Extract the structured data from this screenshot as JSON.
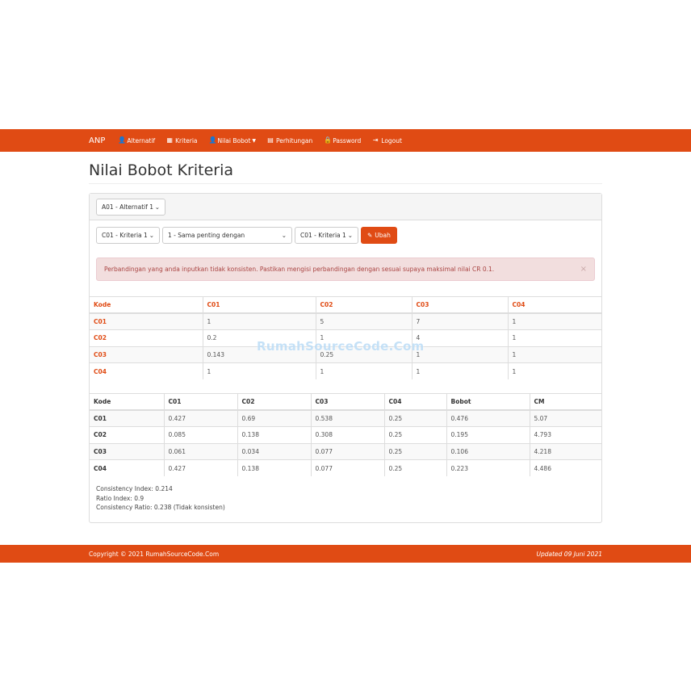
{
  "nav": {
    "brand": "ANP",
    "items": [
      {
        "label": "Alternatif",
        "icon": "user-icon"
      },
      {
        "label": "Kriteria",
        "icon": "grid-icon"
      },
      {
        "label": "Nilai Bobot",
        "icon": "user-icon"
      },
      {
        "label": "Perhitungan",
        "icon": "calendar-icon"
      },
      {
        "label": "Password",
        "icon": "lock-icon"
      },
      {
        "label": "Logout",
        "icon": "logout-icon"
      }
    ]
  },
  "page": {
    "title": "Nilai Bobot Kriteria"
  },
  "form": {
    "alternatif": "A01 - Alternatif 1",
    "kriteria1": "C01 - Kriteria 1",
    "nilai": "1 - Sama penting dengan",
    "kriteria2": "C01 - Kriteria 1",
    "submit": "Ubah"
  },
  "alert": {
    "message": "Perbandingan yang anda inputkan tidak konsisten. Pastikan mengisi perbandingan dengan sesuai supaya maksimal nilai CR 0.1.",
    "close": "×"
  },
  "matrix": {
    "headers": [
      "Kode",
      "C01",
      "C02",
      "C03",
      "C04"
    ],
    "rows": [
      [
        "C01",
        "1",
        "5",
        "7",
        "1"
      ],
      [
        "C02",
        "0.2",
        "1",
        "4",
        "1"
      ],
      [
        "C03",
        "0.143",
        "0.25",
        "1",
        "1"
      ],
      [
        "C04",
        "1",
        "1",
        "1",
        "1"
      ]
    ]
  },
  "normalized": {
    "headers": [
      "Kode",
      "C01",
      "C02",
      "C03",
      "C04",
      "Bobot",
      "CM"
    ],
    "rows": [
      [
        "C01",
        "0.427",
        "0.69",
        "0.538",
        "0.25",
        "0.476",
        "5.07"
      ],
      [
        "C02",
        "0.085",
        "0.138",
        "0.308",
        "0.25",
        "0.195",
        "4.793"
      ],
      [
        "C03",
        "0.061",
        "0.034",
        "0.077",
        "0.25",
        "0.106",
        "4.218"
      ],
      [
        "C04",
        "0.427",
        "0.138",
        "0.077",
        "0.25",
        "0.223",
        "4.486"
      ]
    ]
  },
  "stats": {
    "ci": "Consistency Index: 0.214",
    "ri": "Ratio Index: 0.9",
    "cr": "Consistency Ratio: 0.238 (Tidak konsisten)"
  },
  "watermark": "RumahSourceCode.Com",
  "footer": {
    "copyright": "Copyright © 2021 RumahSourceCode.Com",
    "updated": "Updated 09 Juni 2021"
  },
  "colors": {
    "brand": "#e04b14",
    "alert_bg": "#f2dede",
    "alert_text": "#a94442"
  }
}
